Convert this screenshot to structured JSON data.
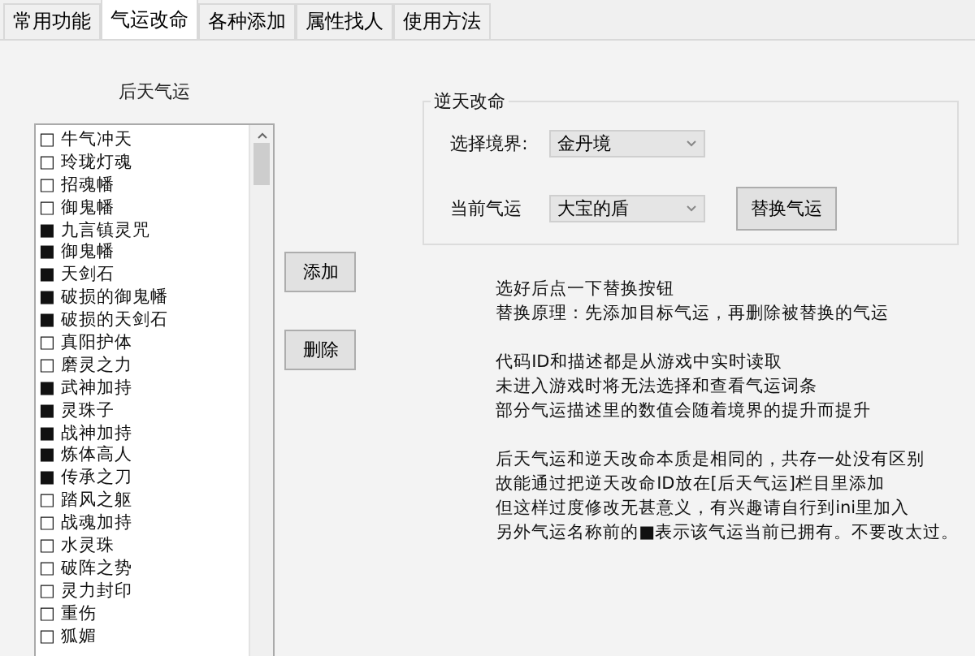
{
  "tabs": [
    {
      "label": "常用功能",
      "selected": false
    },
    {
      "label": "气运改命",
      "selected": true
    },
    {
      "label": "各种添加",
      "selected": false
    },
    {
      "label": "属性找人",
      "selected": false
    },
    {
      "label": "使用方法",
      "selected": false
    }
  ],
  "acquired_luck": {
    "title": "后天气运",
    "items": [
      "□ 牛气冲天",
      "□ 玲珑灯魂",
      "□ 招魂幡",
      "□ 御鬼幡",
      "■ 九言镇灵咒",
      "■ 御鬼幡",
      "■ 天剑石",
      "■ 破损的御鬼幡",
      "■ 破损的天剑石",
      "□ 真阳护体",
      "□ 磨灵之力",
      "■ 武神加持",
      "■ 灵珠子",
      "■ 战神加持",
      "■ 炼体高人",
      "■ 传承之刀",
      "□ 踏风之躯",
      "□ 战魂加持",
      "□ 水灵珠",
      "□ 破阵之势",
      "□ 灵力封印",
      "□ 重伤",
      "□ 狐媚"
    ]
  },
  "actions": [
    "添加",
    "删除"
  ],
  "fate_change": {
    "title": "逆天改命",
    "realm_label": "选择境界:",
    "realm_value": "金丹境",
    "luck_label": "当前气运",
    "luck_value": "大宝的盾",
    "replace_button": "替换气运"
  },
  "notes": [
    [
      "选好后点一下替换按钮",
      "替换原理：先添加目标气运，再删除被替换的气运"
    ],
    [
      "代码ID和描述都是从游戏中实时读取",
      "未进入游戏时将无法选择和查看气运词条",
      "部分气运描述里的数值会随着境界的提升而提升"
    ],
    [
      "后天气运和逆天改命本质是相同的，共存一处没有区别",
      "故能通过把逆天改命ID放在[后天气运]栏目里添加",
      "但这样过度修改无甚意义，有兴趣请自行到ini里加入",
      "另外气运名称前的■表示该气运当前已拥有。不要改太过。"
    ]
  ]
}
